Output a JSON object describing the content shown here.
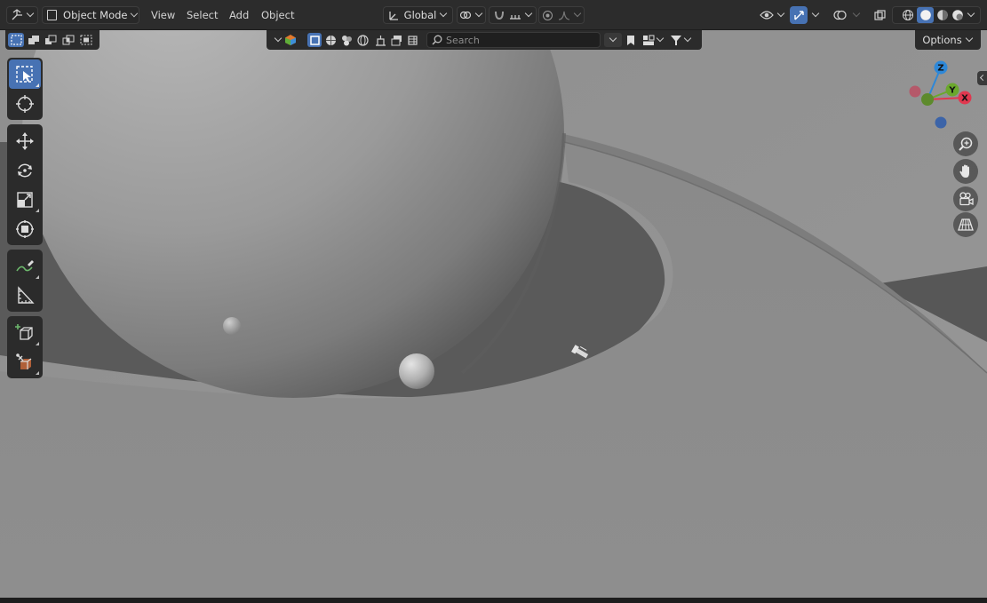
{
  "header": {
    "editor_type_icon": "3d-viewport-icon",
    "mode_label": "Object Mode",
    "menus": [
      "View",
      "Select",
      "Add",
      "Object"
    ],
    "transform_orientation_label": "Global",
    "options_label": "Options"
  },
  "outliner_filter": {
    "search_placeholder": "Search"
  },
  "gizmo": {
    "x_label": "X",
    "y_label": "Y",
    "z_label": "Z",
    "colors": {
      "x": "#e0384f",
      "y": "#6ba82c",
      "z": "#2e88d8"
    }
  },
  "toolbar": {
    "tools": [
      "select-box",
      "cursor",
      "move",
      "rotate",
      "scale",
      "transform",
      "annotate",
      "measure",
      "add-cube",
      "extrude"
    ],
    "active_tool": "select-box"
  },
  "viewport": {
    "shading_active": "solid",
    "accent_color": "#4772b3"
  }
}
